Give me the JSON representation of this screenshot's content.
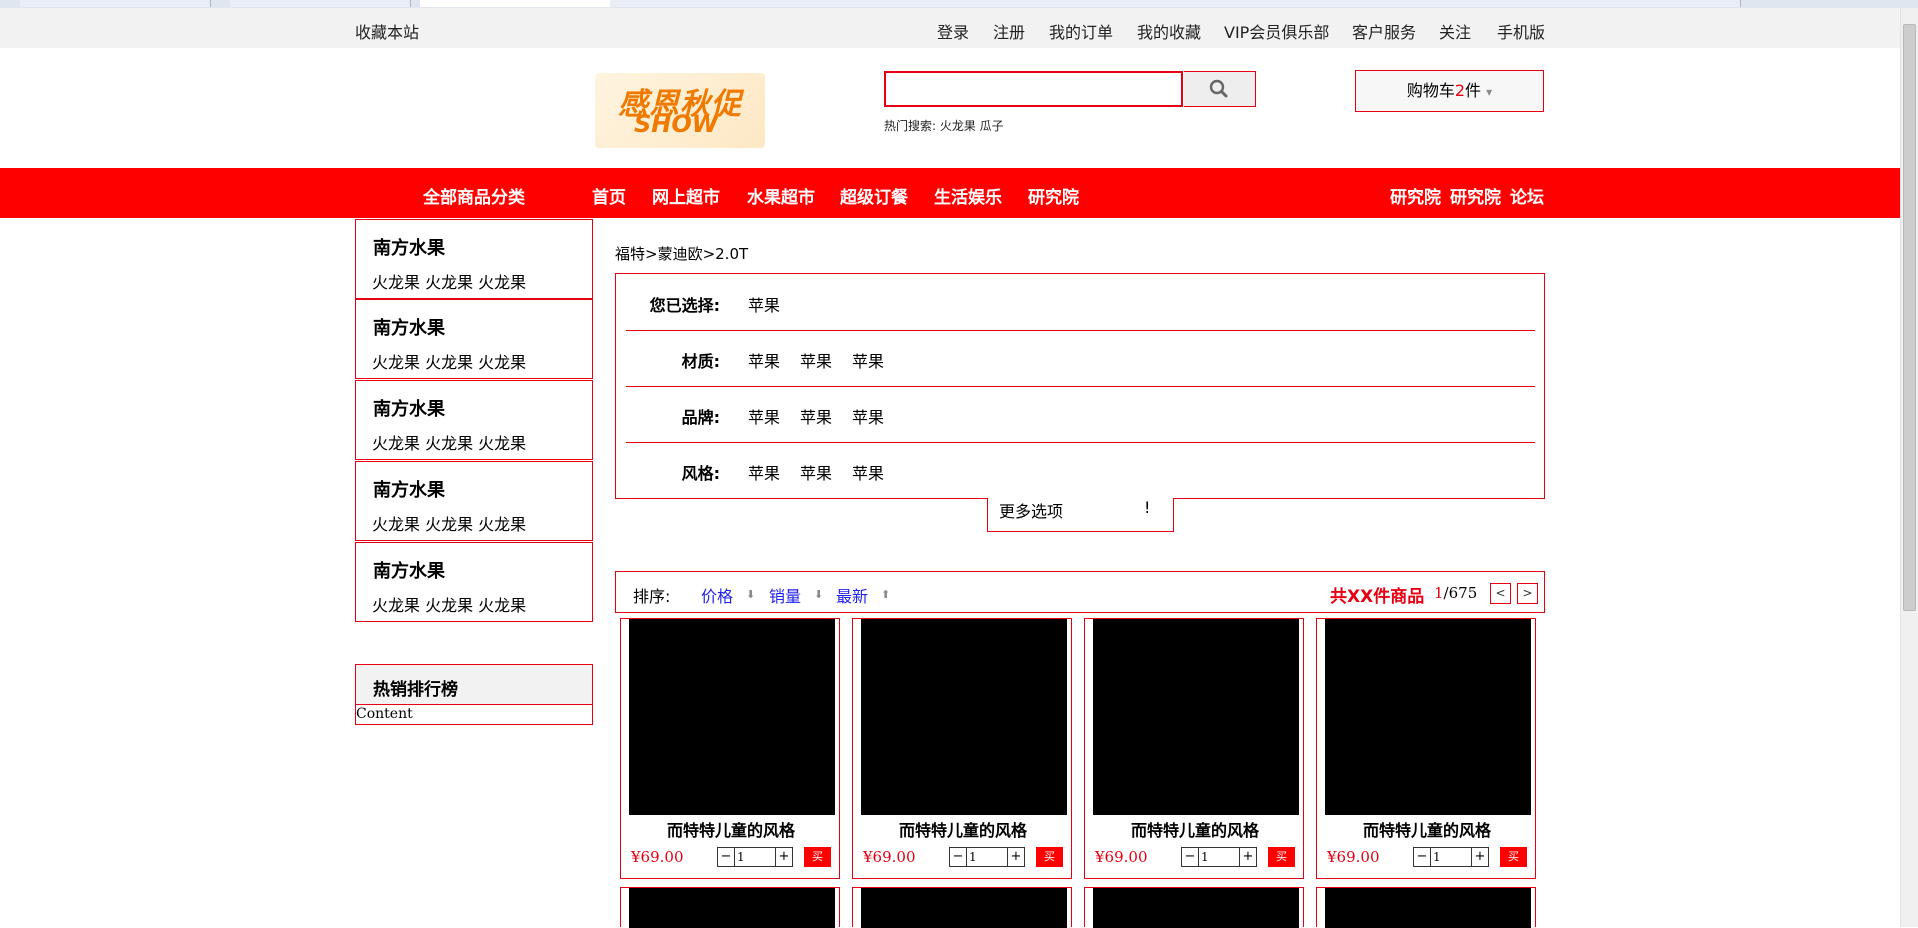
{
  "topbar": {
    "bookmark": "收藏本站",
    "links": [
      "登录",
      "注册",
      "我的订单",
      "我的收藏",
      "VIP会员俱乐部",
      "客户服务",
      "关注",
      "手机版"
    ]
  },
  "header": {
    "logo_line1": "感恩秋促",
    "logo_line2": "SHOW",
    "search_value": "",
    "hot_search": "热门搜索: 火龙果 瓜子",
    "cart_label": "购物车",
    "cart_count": "2",
    "cart_unit": "件",
    "cart_caret": "▾"
  },
  "nav": {
    "all_categories": "全部商品分类",
    "links": [
      "首页",
      "网上超市",
      "水果超市",
      "超级订餐",
      "生活娱乐",
      "研究院"
    ],
    "right_links": [
      "研究院",
      "研究院",
      "论坛"
    ]
  },
  "sidebar": {
    "categories": [
      {
        "title": "南方水果",
        "items": "火龙果 火龙果 火龙果"
      },
      {
        "title": "南方水果",
        "items": "火龙果 火龙果 火龙果"
      },
      {
        "title": "南方水果",
        "items": "火龙果 火龙果 火龙果"
      },
      {
        "title": "南方水果",
        "items": "火龙果 火龙果 火龙果"
      },
      {
        "title": "南方水果",
        "items": "火龙果 火龙果 火龙果"
      }
    ],
    "hot_rank_title": "热销排行榜",
    "hot_rank_content": "Content"
  },
  "breadcrumb": "福特>蒙迪欧>2.0T",
  "filter": {
    "selected_label": "您已选择:",
    "selected_value": "苹果",
    "rows": [
      {
        "label": "材质:",
        "values": [
          "苹果",
          "苹果",
          "苹果"
        ]
      },
      {
        "label": "品牌:",
        "values": [
          "苹果",
          "苹果",
          "苹果"
        ]
      },
      {
        "label": "风格:",
        "values": [
          "苹果",
          "苹果",
          "苹果"
        ]
      }
    ],
    "more_label": "更多选项",
    "more_mark": "!"
  },
  "sortbar": {
    "label": "排序:",
    "options": [
      "价格",
      "销量",
      "最新"
    ],
    "total": "共XX件商品",
    "page_current": "1",
    "page_total": "/675",
    "prev": "<",
    "next": ">"
  },
  "products": [
    {
      "name": "而特特儿童的风格",
      "price": "¥69.00",
      "qty": "1",
      "buy": "买"
    },
    {
      "name": "而特特儿童的风格",
      "price": "¥69.00",
      "qty": "1",
      "buy": "买"
    },
    {
      "name": "而特特儿童的风格",
      "price": "¥69.00",
      "qty": "1",
      "buy": "买"
    },
    {
      "name": "而特特儿童的风格",
      "price": "¥69.00",
      "qty": "1",
      "buy": "买"
    }
  ],
  "stepper": {
    "minus": "−",
    "plus": "+"
  },
  "arrows": {
    "down": "⬇",
    "up": "⬆"
  },
  "colors": {
    "accent": "#ff0000",
    "border": "#e60012",
    "link": "#2222ee"
  }
}
